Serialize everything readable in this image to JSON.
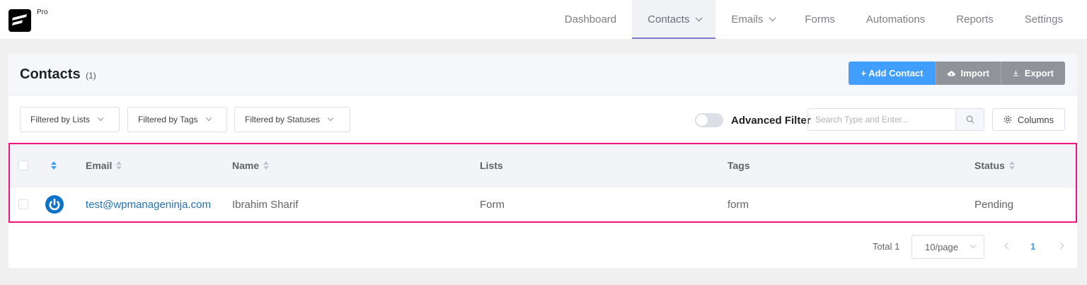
{
  "app": {
    "badge": "Pro"
  },
  "nav": {
    "items": [
      {
        "label": "Dashboard"
      },
      {
        "label": "Contacts"
      },
      {
        "label": "Emails"
      },
      {
        "label": "Forms"
      },
      {
        "label": "Automations"
      },
      {
        "label": "Reports"
      },
      {
        "label": "Settings"
      }
    ],
    "active": "Contacts"
  },
  "header": {
    "title": "Contacts",
    "count": "(1)",
    "add_label": "+ Add Contact",
    "import_label": "Import",
    "export_label": "Export"
  },
  "filters": {
    "lists": "Filtered by Lists",
    "tags": "Filtered by Tags",
    "statuses": "Filtered by Statuses",
    "advanced_label": "Advanced Filter",
    "search_placeholder": "Search Type and Enter...",
    "columns_label": "Columns"
  },
  "table": {
    "columns": {
      "email": "Email",
      "name": "Name",
      "lists": "Lists",
      "tags": "Tags",
      "status": "Status"
    },
    "rows": [
      {
        "email": "test@wpmanageninja.com",
        "name": "Ibrahim Sharif",
        "lists": "Form",
        "tags": "form",
        "status": "Pending"
      }
    ]
  },
  "pagination": {
    "total": "Total 1",
    "page_size": "10/page",
    "current_page": "1"
  },
  "colors": {
    "accent": "#409eff",
    "highlight": "#f0157e",
    "secondary": "#909399"
  }
}
